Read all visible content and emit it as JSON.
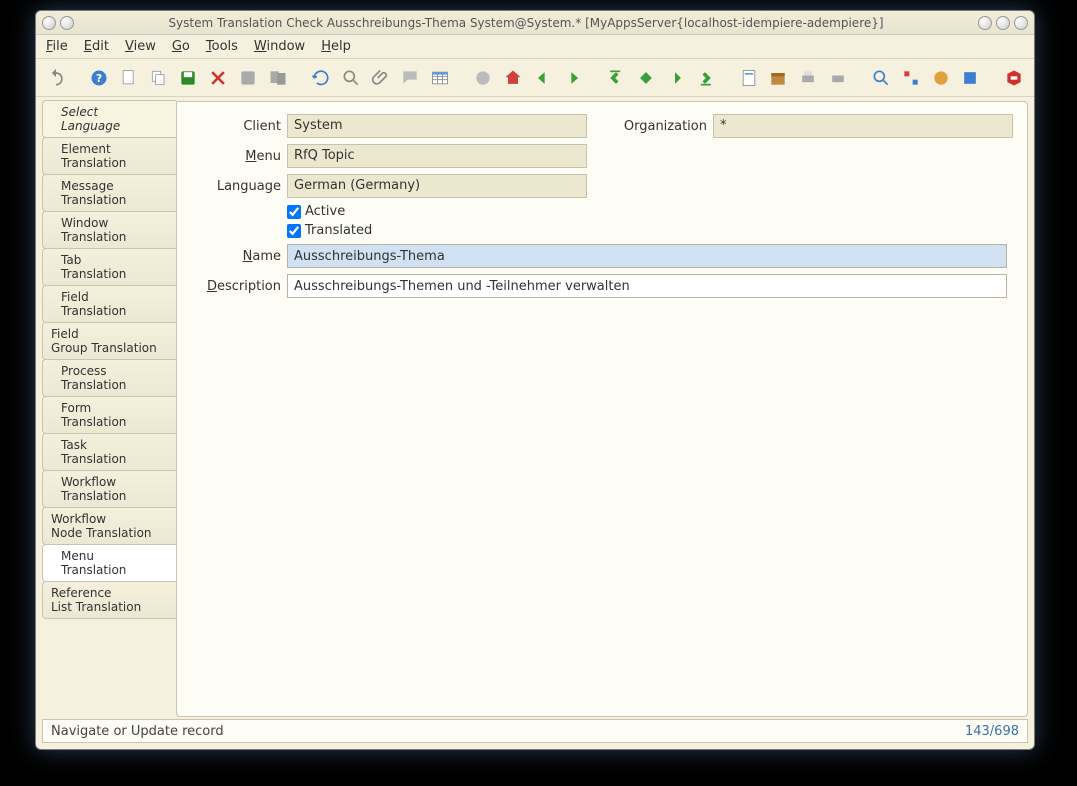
{
  "window": {
    "title": "System Translation Check  Ausschreibungs-Thema  System@System.* [MyAppsServer{localhost-idempiere-adempiere}]"
  },
  "menu": {
    "file": "File",
    "edit": "Edit",
    "view": "View",
    "go": "Go",
    "tools": "Tools",
    "window": "Window",
    "help": "Help"
  },
  "sidebar": {
    "items": [
      {
        "label": "Select Language",
        "indent": true,
        "active": true
      },
      {
        "label": "Element Translation",
        "indent": true
      },
      {
        "label": "Message Translation",
        "indent": true
      },
      {
        "label": "Window Translation",
        "indent": true
      },
      {
        "label": "Tab Translation",
        "indent": true
      },
      {
        "label": "Field Translation",
        "indent": true
      },
      {
        "label": "Field Group Translation",
        "indent": false
      },
      {
        "label": "Process Translation",
        "indent": true
      },
      {
        "label": "Form Translation",
        "indent": true
      },
      {
        "label": "Task Translation",
        "indent": true
      },
      {
        "label": "Workflow Translation",
        "indent": true
      },
      {
        "label": "Workflow Node Translation",
        "indent": false
      },
      {
        "label": "Menu Translation",
        "indent": true,
        "current": true
      },
      {
        "label": "Reference List Translation",
        "indent": false
      }
    ]
  },
  "form": {
    "client_label": "Client",
    "client_value": "System",
    "org_label": "Organization",
    "org_value": "*",
    "menu_label": "Menu",
    "menu_value": "RfQ Topic",
    "language_label": "Language",
    "language_value": "German (Germany)",
    "active_label": "Active",
    "active_checked": true,
    "translated_label": "Translated",
    "translated_checked": true,
    "name_label": "Name",
    "name_value": "Ausschreibungs-Thema",
    "description_label": "Description",
    "description_value": "Ausschreibungs-Themen und -Teilnehmer verwalten"
  },
  "status": {
    "message": "Navigate or Update record",
    "counter": "143/698"
  },
  "icons": {
    "undo": "undo",
    "help": "help",
    "new": "new",
    "copy": "copy",
    "save": "save",
    "ignore": "ignore",
    "delete": "delete",
    "delete-sel": "delete-sel",
    "refresh": "refresh",
    "find": "find",
    "attach": "attach",
    "chat": "chat",
    "grid": "grid",
    "history": "history",
    "home": "home",
    "back": "back",
    "forward": "forward",
    "first": "first",
    "prev": "prev",
    "next": "next",
    "last": "last",
    "report": "report",
    "archive": "archive",
    "print": "print",
    "print-preview": "print-preview",
    "zoom": "zoom",
    "lock": "lock",
    "process": "process",
    "product": "product",
    "close": "close"
  }
}
